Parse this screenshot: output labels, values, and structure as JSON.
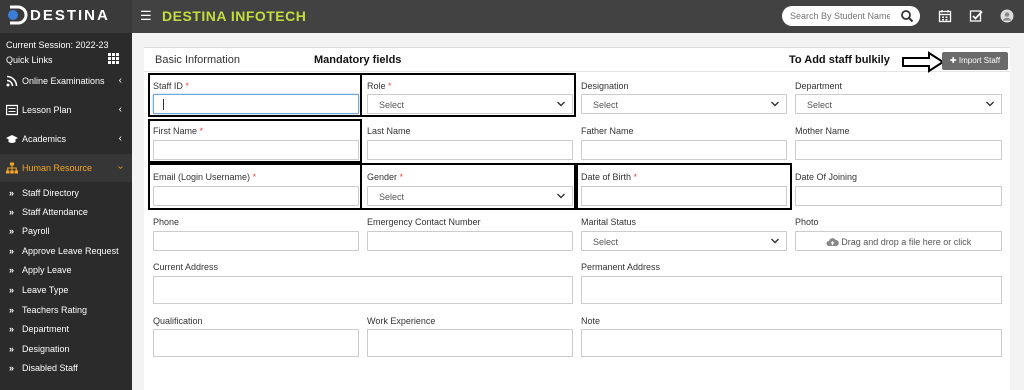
{
  "app": {
    "title": "DESTINA INFOTECH",
    "logo": "DESTINA"
  },
  "search": {
    "placeholder": "Search By Student Name"
  },
  "sidebar": {
    "session": "Current Session: 2022-23",
    "quick_links": "Quick Links",
    "nav": [
      {
        "label": "Online Examinations",
        "icon": "rss-icon"
      },
      {
        "label": "Lesson Plan",
        "icon": "list-icon"
      },
      {
        "label": "Academics",
        "icon": "graduation-cap-icon"
      },
      {
        "label": "Human Resource",
        "icon": "sitemap-icon"
      }
    ],
    "sub": [
      "Staff Directory",
      "Staff Attendance",
      "Payroll",
      "Approve Leave Request",
      "Apply Leave",
      "Leave Type",
      "Teachers Rating",
      "Department",
      "Designation",
      "Disabled Staff"
    ]
  },
  "panel": {
    "title": "Basic Information",
    "mandatory_note": "Mandatory fields",
    "bulk_note": "To Add staff bulkily",
    "import_button": "Import Staff"
  },
  "form": {
    "staff_id": "Staff ID",
    "role": "Role",
    "designation": "Designation",
    "department": "Department",
    "first_name": "First Name",
    "last_name": "Last Name",
    "father_name": "Father Name",
    "mother_name": "Mother Name",
    "email": "Email (Login Username)",
    "gender": "Gender",
    "dob": "Date of Birth",
    "doj": "Date Of Joining",
    "phone": "Phone",
    "emergency": "Emergency Contact Number",
    "marital": "Marital Status",
    "photo": "Photo",
    "photo_drop": "Drag and drop a file here or click",
    "current_address": "Current Address",
    "permanent_address": "Permanent Address",
    "qualification": "Qualification",
    "experience": "Work Experience",
    "note": "Note",
    "select_text": "Select",
    "required_mark": "*"
  },
  "colors": {
    "topbar": "#424242",
    "sidebar": "#2b2b2b",
    "brand": "#c3dd3c",
    "active": "#f5a623",
    "required": "#e74c3c"
  }
}
